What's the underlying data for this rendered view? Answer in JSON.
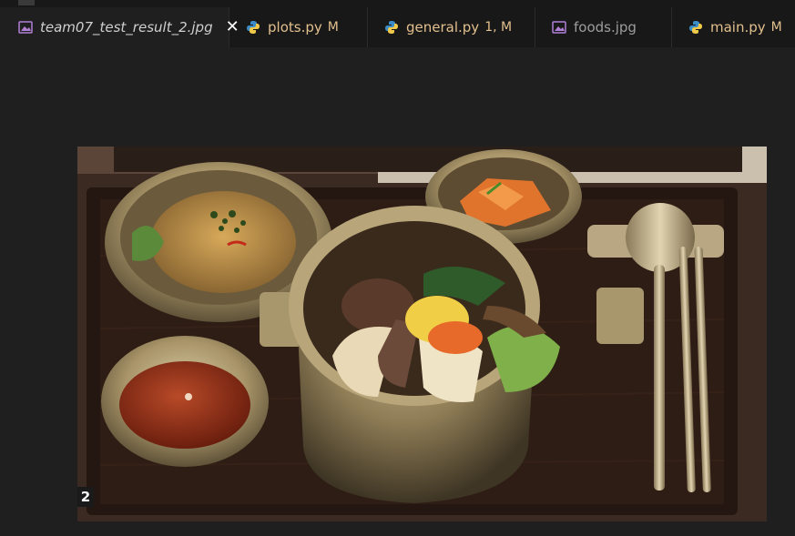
{
  "tabs": [
    {
      "label": "team07_test_result_2.jpg",
      "icon": "image-icon",
      "badge": "",
      "active": true
    },
    {
      "label": "plots.py",
      "icon": "python-icon",
      "badge": "M",
      "active": false
    },
    {
      "label": "general.py",
      "icon": "python-icon",
      "badge": "1, M",
      "active": false
    },
    {
      "label": "foods.jpg",
      "icon": "image-icon",
      "badge": "",
      "active": false
    },
    {
      "label": "main.py",
      "icon": "python-icon",
      "badge": "M",
      "active": false
    }
  ],
  "image_preview": {
    "corner_label": "2"
  },
  "colors": {
    "accent_modified": "#e2c08d",
    "python_icon": "#3c8cc8",
    "image_icon": "#b180d7"
  }
}
